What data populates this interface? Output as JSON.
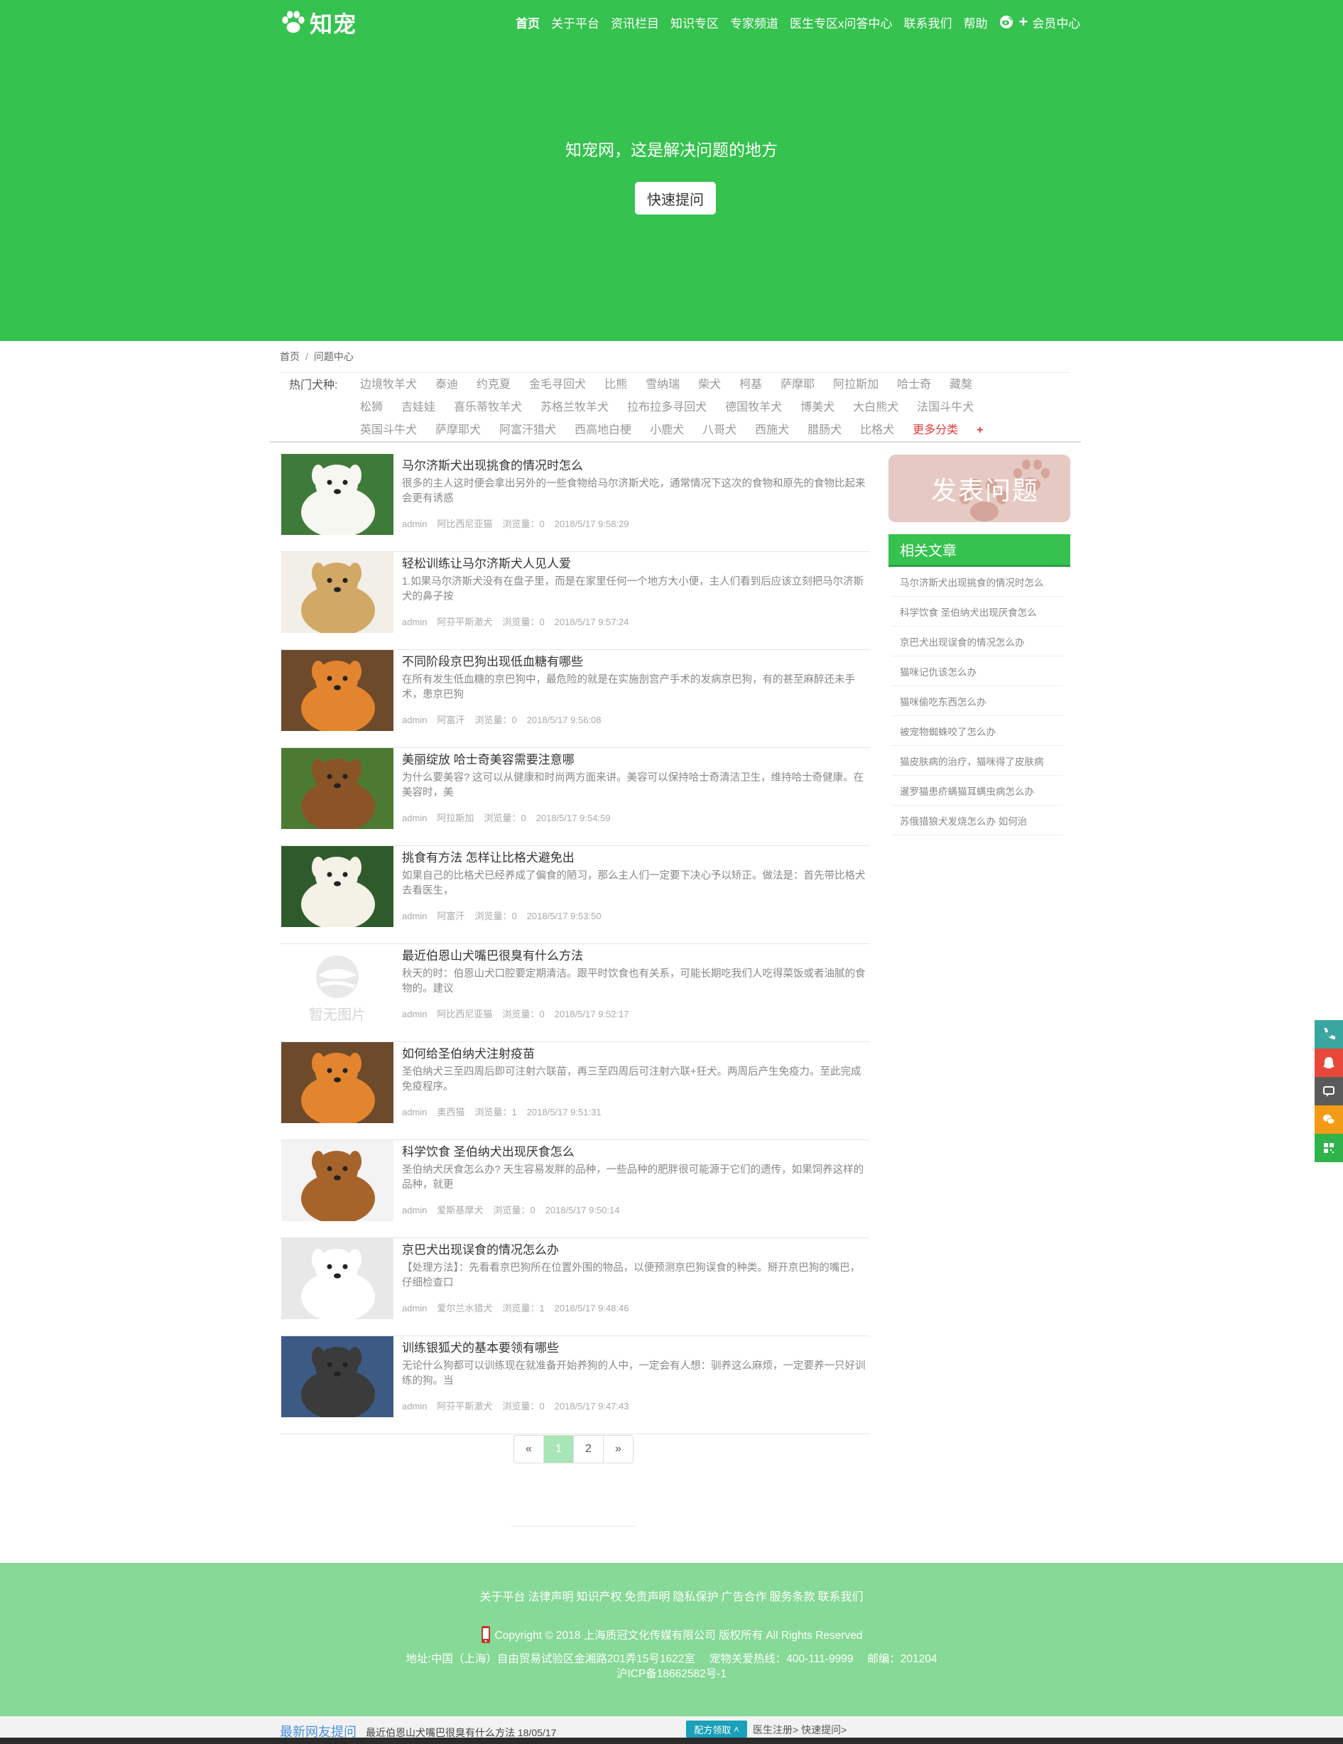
{
  "brand": {
    "logo_text": "知宠"
  },
  "nav": {
    "items": [
      "首页",
      "关于平台",
      "资讯栏目",
      "知识专区",
      "专家频道",
      "医生专区x问答中心",
      "联系我们",
      "帮助"
    ],
    "member": "会员中心"
  },
  "hero": {
    "title": "知宠网，这是解决问题的地方",
    "button": "快速提问"
  },
  "breadcrumb": {
    "home": "首页",
    "sep": "/",
    "current": "问题中心"
  },
  "tags": {
    "label": "热门犬种:",
    "items": [
      "边境牧羊犬",
      "泰迪",
      "约克夏",
      "金毛寻回犬",
      "比熊",
      "雪纳瑞",
      "柴犬",
      "柯基",
      "萨摩耶",
      "阿拉斯加",
      "哈士奇",
      "藏獒",
      "松狮",
      "吉娃娃",
      "喜乐蒂牧羊犬",
      "苏格兰牧羊犬",
      "拉布拉多寻回犬",
      "德国牧羊犬",
      "博美犬",
      "大白熊犬",
      "法国斗牛犬",
      "英国斗牛犬",
      "萨摩耶犬",
      "阿富汗猎犬",
      "西高地白梗",
      "小鹿犬",
      "八哥犬",
      "西施犬",
      "腊肠犬",
      "比格犬"
    ],
    "more": "更多分类",
    "more_icon": "+"
  },
  "articles": [
    {
      "title": "马尔济斯犬出现挑食的情况时怎么",
      "desc": "很多的主人这时便会拿出另外的一些食物给马尔济斯犬吃，通常情况下这次的食物和原先的食物比起来会更有诱惑",
      "author": "admin",
      "tag": "阿比西尼亚猫",
      "views": "浏览量：0",
      "date": "2018/5/17 9:58:29",
      "image": "white-samoyed"
    },
    {
      "title": "轻松训练让马尔济斯犬人见人爱",
      "desc": "1.如果马尔济斯犬没有在盘子里，而是在家里任何一个地方大小便，主人们看到后应该立刻把马尔济斯犬的鼻子按",
      "author": "admin",
      "tag": "阿芬平斯澈犬",
      "views": "浏览量：0",
      "date": "2018/5/17 9:57:24",
      "image": "golden-afghan"
    },
    {
      "title": "不同阶段京巴狗出现低血糖有哪些",
      "desc": "在所有发生低血糖的京巴狗中，最危险的就是在实施剖宫产手术的发病京巴狗，有的甚至麻醉还未手术，患京巴狗",
      "author": "admin",
      "tag": "阿富汗",
      "views": "浏览量：0",
      "date": "2018/5/17 9:56:08",
      "image": "pomeranian"
    },
    {
      "title": "美丽绽放 哈士奇美容需要注意哪",
      "desc": "为什么要美容? 这可以从健康和时尚两方面来讲。美容可以保持哈士奇清洁卫生，维持哈士奇健康。在美容时，美",
      "author": "admin",
      "tag": "阿拉斯加",
      "views": "浏览量：0",
      "date": "2018/5/17 9:54:59",
      "image": "beagle-outdoor"
    },
    {
      "title": "挑食有方法 怎样让比格犬避免出",
      "desc": "如果自己的比格犬已经养成了偏食的陋习，那么主人们一定要下决心予以矫正。做法是：首先带比格犬去看医生，",
      "author": "admin",
      "tag": "阿富汗",
      "views": "浏览量：0",
      "date": "2018/5/17 9:53:50",
      "image": "white-dog-grass"
    },
    {
      "title": "最近伯恩山犬嘴巴很臭有什么方法",
      "desc": "秋天的时：伯恩山犬口腔要定期清洁。跟平时饮食也有关系，可能长期吃我们人吃得菜饭或者油腻的食物的。建议",
      "author": "admin",
      "tag": "阿比西尼亚猫",
      "views": "浏览量：0",
      "date": "2018/5/17 9:52:17",
      "image": "placeholder",
      "placeholder_text": "暂无图片"
    },
    {
      "title": "如何给圣伯纳犬注射疫苗",
      "desc": "圣伯纳犬三至四周后即可注射六联苗，再三至四周后可注射六联+狂犬。两周后产生免疫力。至此完成免疫程序。",
      "author": "admin",
      "tag": "奥西猫",
      "views": "浏览量：1",
      "date": "2018/5/17 9:51:31",
      "image": "pomeranian"
    },
    {
      "title": "科学饮食 圣伯纳犬出现厌食怎么",
      "desc": "圣伯纳犬厌食怎么办? 天生容易发胖的品种，一些品种的肥胖很可能源于它们的遗传，如果饲养这样的品种，就更",
      "author": "admin",
      "tag": "爱斯基摩犬",
      "views": "浏览量：0",
      "date": "2018/5/17 9:50:14",
      "image": "beagle-lying"
    },
    {
      "title": "京巴犬出现误食的情况怎么办",
      "desc": "【处理方法】：先看看京巴狗所在位置外围的物品，以便预测京巴狗误食的种类。掰开京巴狗的嘴巴，仔细检查口",
      "author": "admin",
      "tag": "爱尔兰水猎犬",
      "views": "浏览量：1",
      "date": "2018/5/17 9:48:46",
      "image": "white-spitz"
    },
    {
      "title": "训练银狐犬的基本要领有哪些",
      "desc": "无论什么狗都可以训练现在就准备开始养狗的人中，一定会有人想：驯养这么麻烦，一定要养一只好训练的狗。当",
      "author": "admin",
      "tag": "阿芬平斯澈犬",
      "views": "浏览量：0",
      "date": "2018/5/17 9:47:43",
      "image": "husky"
    }
  ],
  "pagination": {
    "prev": "«",
    "pages": [
      "1",
      "2"
    ],
    "current": "1",
    "next": "»"
  },
  "sidebar": {
    "post_question": "发表问题",
    "related_title": "相关文章",
    "related": [
      "马尔济斯犬出现挑食的情况时怎么",
      "科学饮食 圣伯纳犬出现厌食怎么",
      "京巴犬出现误食的情况怎么办",
      "猫咪记仇该怎么办",
      "猫咪偷吃东西怎么办",
      "被宠物蜘蛛咬了怎么办",
      "猫皮肤病的治疗，猫咪得了皮肤病",
      "暹罗猫患疥螨猫耳螨虫病怎么办",
      "苏俄猎狼犬发烧怎么办 如何治"
    ]
  },
  "float_bar": [
    {
      "icon": "phone-icon",
      "color": "#3aa6a0"
    },
    {
      "icon": "qq-icon",
      "color": "#e8483a"
    },
    {
      "icon": "message-icon",
      "color": "#5a5a5a"
    },
    {
      "icon": "wechat-icon",
      "color": "#f39b16"
    },
    {
      "icon": "qrcode-icon",
      "color": "#2fb34a"
    }
  ],
  "footer": {
    "links": [
      "关于平台",
      "法律声明",
      "知识产权",
      "免责声明",
      "隐私保护",
      "广告合作",
      "服务条款",
      "联系我们"
    ],
    "copyright": "Copyright © 2018 上海质冠文化传媒有限公司 版权所有 All Rights Reserved",
    "address": "地址:中国（上海）自由贸易试验区金湘路201弄15号1622室　 宠物关爱热线：400-111-9999　 邮编：201204",
    "icp": "沪ICP备18662582号-1"
  },
  "bottom_bar": {
    "latest_label": "最新网友提问",
    "latest_text": "最近伯恩山犬嘴巴很臭有什么方法 18/05/17",
    "recipe_button": "配方领取",
    "links": "医生注册> 快速提问>"
  },
  "colors": {
    "brand_green": "#35c24f",
    "footer_green": "#86d996",
    "more_red": "#e4393c"
  }
}
